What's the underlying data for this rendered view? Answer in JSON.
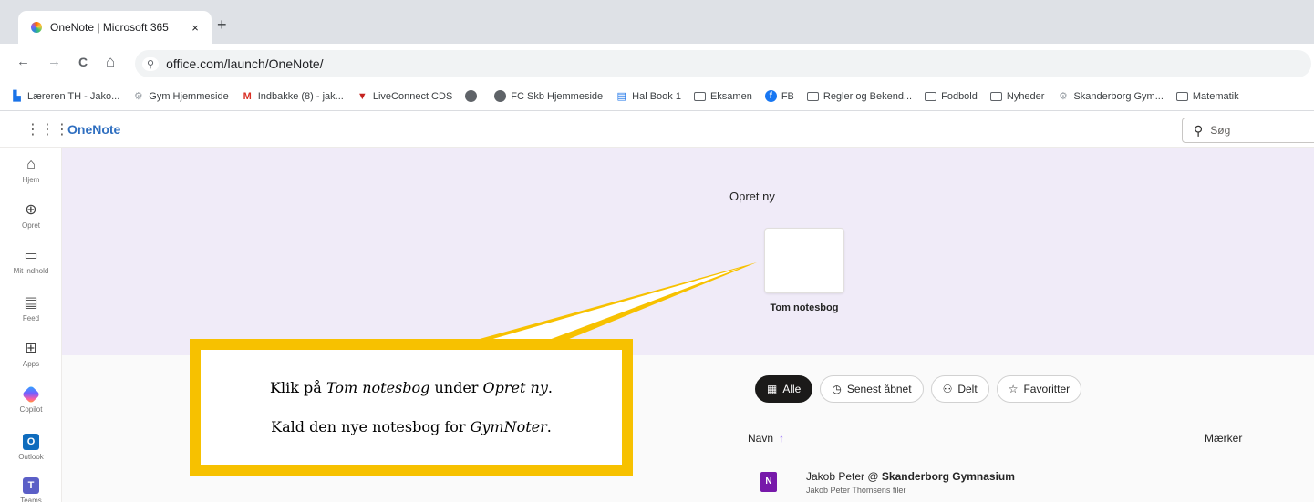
{
  "browser": {
    "tab_title": "OneNote | Microsoft 365",
    "tab_close": "×",
    "new_tab": "+",
    "nav": {
      "back": "←",
      "forward": "→",
      "reload": "C",
      "home": "⌂"
    },
    "url": "office.com/launch/OneNote/",
    "bookmarks": [
      {
        "icon": "sheet-icon",
        "glyph": "▙",
        "label": "Læreren TH - Jako..."
      },
      {
        "icon": "school-icon",
        "glyph": "⚙",
        "label": "Gym Hjemmeside"
      },
      {
        "icon": "gmail-icon",
        "glyph": "M",
        "label": "Indbakke (8) - jak..."
      },
      {
        "icon": "liveconnect-icon",
        "glyph": "▼",
        "label": "LiveConnect CDS"
      },
      {
        "icon": "globe-icon",
        "glyph": "",
        "label": ""
      },
      {
        "icon": "globe-icon",
        "glyph": "",
        "label": "FC Skb Hjemmeside"
      },
      {
        "icon": "sheet-icon",
        "glyph": "▤",
        "label": "Hal Book 1"
      },
      {
        "icon": "folder-icon",
        "glyph": "",
        "label": "Eksamen"
      },
      {
        "icon": "facebook-icon",
        "glyph": "f",
        "label": "FB"
      },
      {
        "icon": "folder-icon",
        "glyph": "",
        "label": "Regler og Bekend..."
      },
      {
        "icon": "folder-icon",
        "glyph": "",
        "label": "Fodbold"
      },
      {
        "icon": "folder-icon",
        "glyph": "",
        "label": "Nyheder"
      },
      {
        "icon": "school-icon",
        "glyph": "⚙",
        "label": "Skanderborg Gym..."
      },
      {
        "icon": "folder-icon",
        "glyph": "",
        "label": "Matematik"
      }
    ]
  },
  "app": {
    "name": "OneNote",
    "search_placeholder": "Søg",
    "rail": [
      {
        "icon": "home-icon",
        "glyph": "⌂",
        "label": "Hjem"
      },
      {
        "icon": "create-icon",
        "glyph": "⊕",
        "label": "Opret"
      },
      {
        "icon": "my-content-icon",
        "glyph": "▭",
        "label": "Mit indhold"
      },
      {
        "icon": "feed-icon",
        "glyph": "▤",
        "label": "Feed"
      },
      {
        "icon": "apps-icon",
        "glyph": "⊞",
        "label": "Apps"
      },
      {
        "icon": "copilot-icon",
        "glyph": "",
        "label": "Copilot"
      },
      {
        "icon": "outlook-icon",
        "glyph": "O",
        "label": "Outlook"
      },
      {
        "icon": "teams-icon",
        "glyph": "T",
        "label": "Teams"
      }
    ],
    "create": {
      "title": "Opret ny",
      "blank_notebook": "Tom notesbog"
    },
    "filters": [
      {
        "icon": "all-icon",
        "glyph": "▦",
        "label": "Alle",
        "active": true
      },
      {
        "icon": "clock-icon",
        "glyph": "◷",
        "label": "Senest åbnet",
        "active": false
      },
      {
        "icon": "people-icon",
        "glyph": "⚇",
        "label": "Delt",
        "active": false
      },
      {
        "icon": "star-icon",
        "glyph": "☆",
        "label": "Favoritter",
        "active": false
      }
    ],
    "list": {
      "col_name": "Navn",
      "sort_arrow": "↑",
      "col_tags": "Mærker",
      "rows": [
        {
          "title_prefix": "Jakob Peter @ ",
          "title_bold": "Skanderborg Gymnasium",
          "subtitle": "Jakob Peter Thomsens filer",
          "icon_letter": "N"
        }
      ]
    }
  },
  "callout": {
    "line1": {
      "a": "Klik på ",
      "b": "Tom notesbog",
      "c": " under ",
      "d": "Opret ny",
      "e": "."
    },
    "line2": {
      "a": "Kald den nye notesbog for ",
      "b": "GymNoter",
      "c": "."
    },
    "color": "#f7c100"
  }
}
